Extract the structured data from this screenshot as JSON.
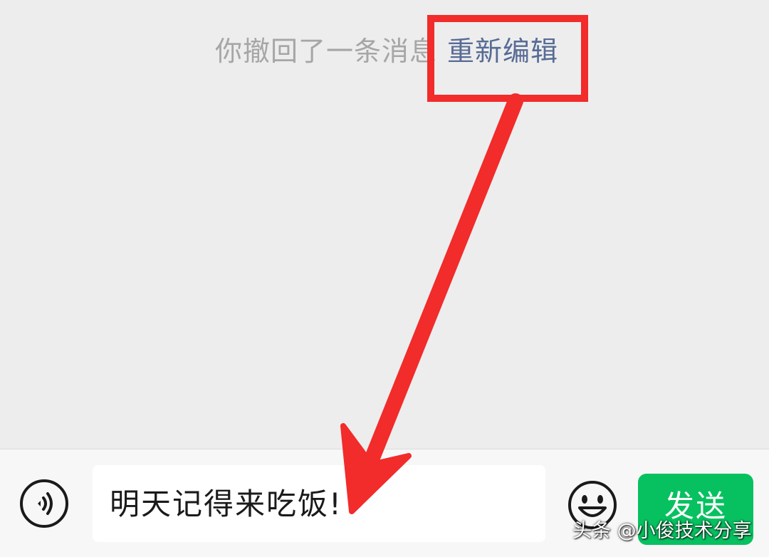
{
  "chat": {
    "recall_notice": "你撤回了一条消息",
    "reedit_link": "重新编辑"
  },
  "input_bar": {
    "voice_icon": "voice-wave-icon",
    "input_value": "明天记得来吃饭!",
    "emoji_icon": "smiley-face-icon",
    "send_label": "发送"
  },
  "watermark": {
    "text": "头条 @小俊技术分享"
  },
  "colors": {
    "background": "#ededed",
    "recall_text": "#a6a6a6",
    "link": "#576b95",
    "annotation_red": "#f22b2b",
    "send_green": "#07c160",
    "input_bar": "#f7f7f7"
  }
}
